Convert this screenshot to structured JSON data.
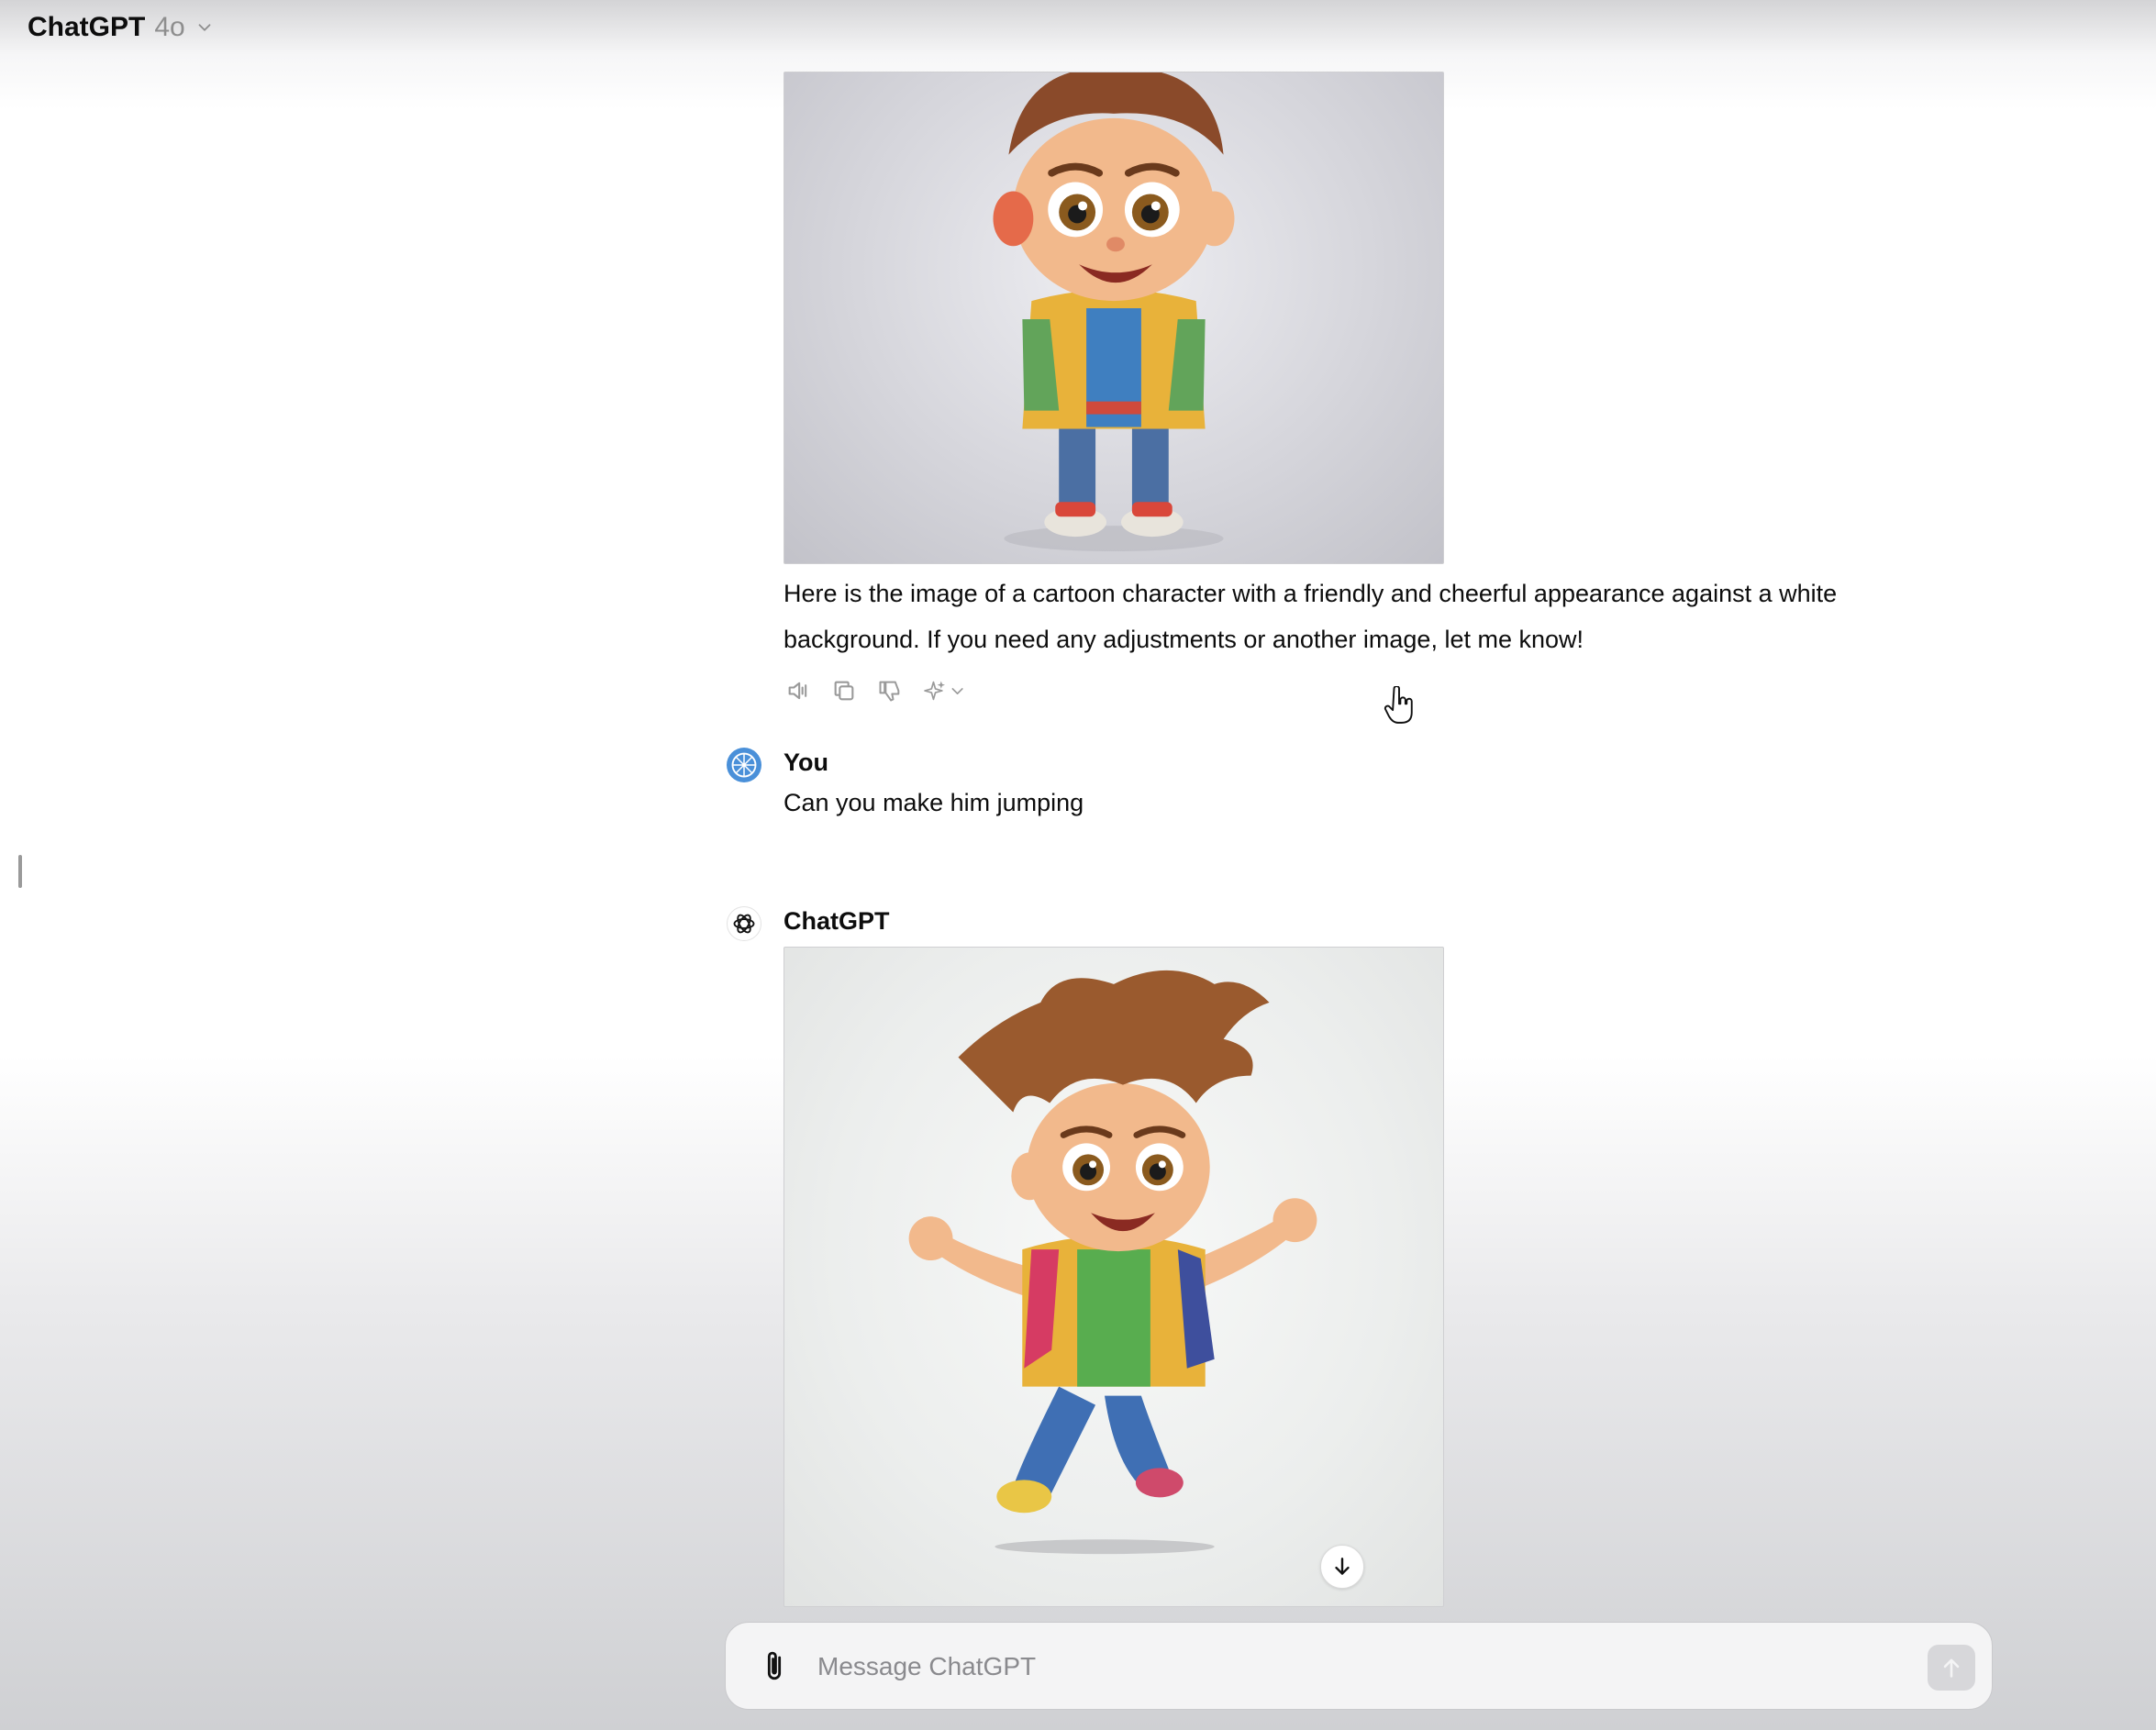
{
  "header": {
    "model_name": "ChatGPT",
    "model_version": "4o",
    "switcher_icon": "chevron-down-icon"
  },
  "conversation": {
    "first_image": {
      "kind": "generated-image",
      "subject": "cartoon boy standing"
    },
    "assistant_reply": "Here is the image of a cartoon character with a friendly and cheerful appearance against a white background. If you need any adjustments or another image, let me know!",
    "reply_actions": [
      {
        "icon": "speaker-icon"
      },
      {
        "icon": "copy-icon"
      },
      {
        "icon": "thumbs-down-icon"
      },
      {
        "icon": "sparkle-regenerate-icon"
      }
    ],
    "user_turn": {
      "author": "You",
      "text": "Can you make him jumping"
    },
    "assistant_turn": {
      "author": "ChatGPT",
      "image": {
        "kind": "generated-image",
        "subject": "cartoon boy jumping"
      },
      "download_icon": "arrow-down-icon"
    }
  },
  "composer": {
    "placeholder": "Message ChatGPT",
    "value": "",
    "attach_icon": "paperclip-icon",
    "send_icon": "arrow-up-icon"
  },
  "colors": {
    "text": "#0d0d0d",
    "muted": "#8e8e8e",
    "user_avatar": "#4a90d9"
  }
}
